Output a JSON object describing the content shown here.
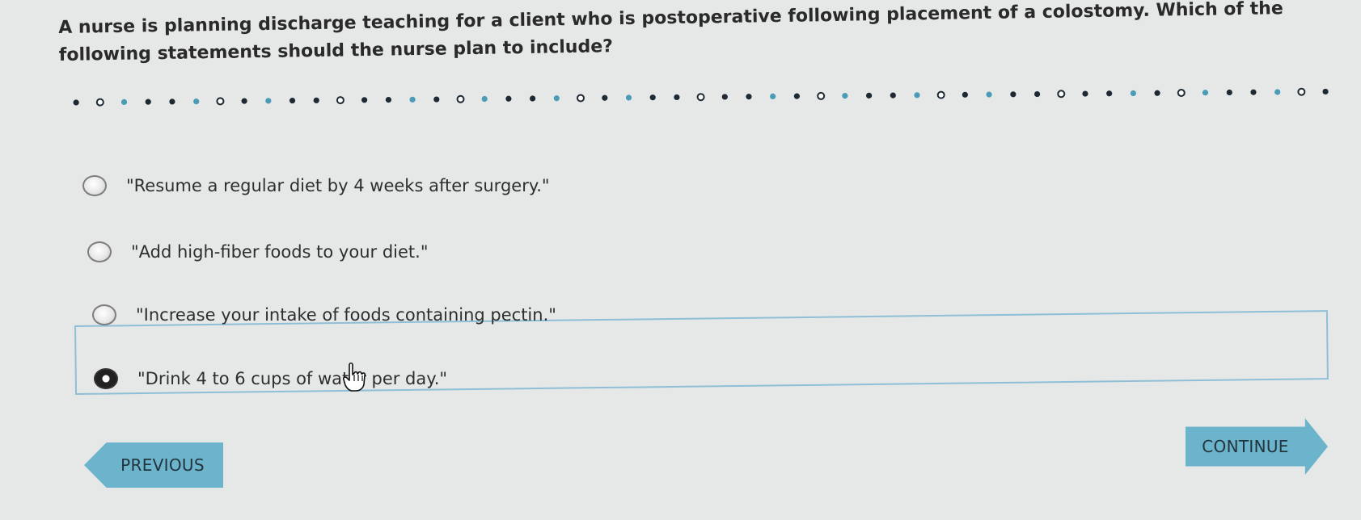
{
  "question": {
    "text": "A nurse is planning discharge teaching for a client who is postoperative following placement of a colostomy. Which of the following statements should the nurse plan to include?"
  },
  "options": [
    {
      "text": "\"Resume a regular diet by 4 weeks after surgery.\"",
      "selected": false
    },
    {
      "text": "\"Add high-fiber foods to your diet.\"",
      "selected": false
    },
    {
      "text": "\"Increase your intake of foods containing pectin.\"",
      "selected": false
    },
    {
      "text": "\"Drink 4 to 6 cups of water per day.\"",
      "selected": true
    }
  ],
  "navigation": {
    "previous_label": "PREVIOUS",
    "continue_label": "CONTINUE"
  },
  "colors": {
    "background": "#e6e8e8",
    "button": "#6bb4cc",
    "selected_border": "#8fbfd6",
    "dot_dark": "#1e2a33",
    "dot_teal": "#4a9bb5"
  },
  "icons": {
    "cursor": "hand-pointer-icon"
  }
}
